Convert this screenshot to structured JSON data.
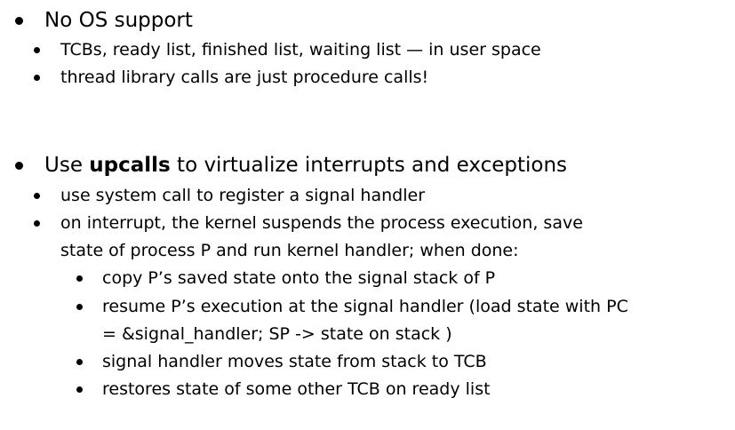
{
  "sections": [
    {
      "heading": "No OS support",
      "items": [
        "TCBs, ready list, finished list, waiting list — in user space",
        "thread library calls are just procedure calls!"
      ]
    },
    {
      "heading_pre": "Use ",
      "heading_bold": "upcalls",
      "heading_post": " to virtualize interrupts and exceptions",
      "items": [
        "use system call to register a signal handler",
        "on interrupt, the kernel suspends the process execution, save",
        "state of process P and run kernel handler;   when done:"
      ],
      "subitems": [
        "copy P’s saved state onto the signal stack of P",
        "resume P’s execution at the signal handler (load state with PC",
        "= &signal_handler; SP -> state on stack  )",
        "signal handler moves state from stack to TCB",
        "restores state of some other TCB on ready list"
      ]
    }
  ]
}
